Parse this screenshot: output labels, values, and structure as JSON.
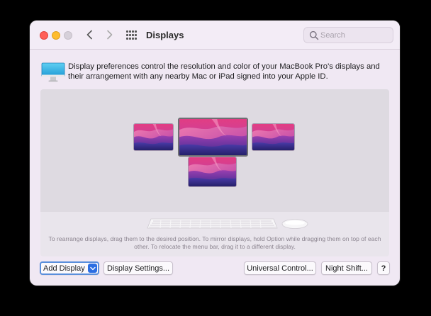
{
  "window": {
    "title": "Displays",
    "search": {
      "placeholder": "Search"
    }
  },
  "intro": {
    "text": "Display preferences control the resolution and color of your MacBook Pro's displays and their arrangement with any nearby Mac or iPad signed into your Apple ID."
  },
  "arrangement": {
    "displays": [
      "display-left",
      "display-main",
      "display-right",
      "display-bottom"
    ],
    "hint": "To rearrange displays, drag them to the desired position. To mirror displays, hold Option while dragging them on top of each other. To relocate the menu bar, drag it to a different display."
  },
  "buttons": {
    "add_display": "Add Display",
    "display_settings": "Display Settings...",
    "universal_control": "Universal Control...",
    "night_shift": "Night Shift...",
    "help": "?"
  },
  "colors": {
    "accent": "#2c6ee2",
    "window_bg": "#f0e8f3",
    "close": "#ff5f57",
    "minimize": "#febc2e"
  },
  "icons": [
    "chevron-left-icon",
    "chevron-right-icon",
    "grid-icon",
    "search-icon",
    "monitor-icon",
    "chevron-down-icon",
    "keyboard-icon",
    "mouse-icon"
  ]
}
